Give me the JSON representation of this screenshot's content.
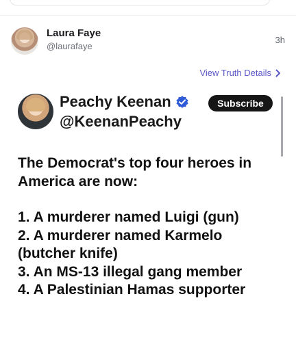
{
  "post": {
    "author_name": "Laura Faye",
    "author_handle": "@laurafaye",
    "time": "3h",
    "view_details_label": "View Truth Details"
  },
  "embedded": {
    "name": "Peachy Keenan",
    "handle": "@KeenanPeachy",
    "subscribe_label": "Subscribe",
    "intro_line1": "The Democrat's top four heroes in",
    "intro_line2": "America are now:",
    "items": [
      "1. A murderer named Luigi (gun)",
      "2. A murderer named Karmelo",
      "(butcher knife)",
      "3. An MS-13 illegal gang member",
      "4. A Palestinian Hamas supporter"
    ]
  },
  "icons": {
    "verified": "verified-badge-icon",
    "chevron": "chevron-right-icon"
  },
  "colors": {
    "link": "#5b58c7",
    "verified": "#2f5bd8",
    "subscribe_bg": "#161616"
  }
}
